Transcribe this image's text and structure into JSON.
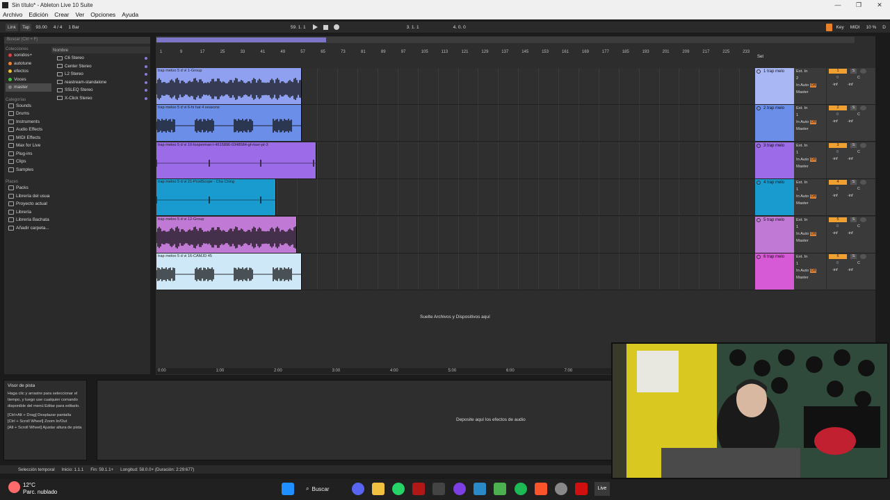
{
  "window": {
    "title": "Sin título* - Ableton Live 10 Suite",
    "controls": [
      "—",
      "❐",
      "✕"
    ]
  },
  "menu": [
    "Archivo",
    "Edición",
    "Crear",
    "Ver",
    "Opciones",
    "Ayuda"
  ],
  "transport": {
    "link": "Link",
    "tap": "Tap",
    "tempo": "93.00",
    "signature": "4 / 4",
    "quantize": "1 Bar",
    "position": "59.  1.  1",
    "loop_start": "3.  1.  1",
    "loop_length": "4.  0.  0",
    "key": "Key",
    "midi": "MIDI",
    "cpu": "10 %",
    "disk": "D"
  },
  "browser": {
    "search_placeholder": "Buscar (Ctrl + F)",
    "collections_label": "Colecciones",
    "collections": [
      {
        "label": "sonidos+",
        "color": "#e04040"
      },
      {
        "label": "autotune",
        "color": "#f08030"
      },
      {
        "label": "efectos",
        "color": "#f0c030"
      },
      {
        "label": "Voces",
        "color": "#40c040"
      },
      {
        "label": "master",
        "color": "#808080"
      }
    ],
    "categories_label": "Categorías",
    "categories": [
      "Sounds",
      "Drums",
      "Instruments",
      "Audio Effects",
      "MIDI Effects",
      "Max for Live",
      "Plug-ins",
      "Clips",
      "Samples"
    ],
    "places_label": "Places",
    "places": [
      "Packs",
      "Librería del usua",
      "Proyecto actual",
      "Librería",
      "Librería Bachata",
      "Añadir carpeta..."
    ],
    "name_header": "Nombre",
    "files": [
      "C6 Stereo",
      "Center Stereo",
      "L2 Stereo",
      "reastream-standalone",
      "SSLEQ Stereo",
      "X-Click Stereo"
    ]
  },
  "ruler": [
    "1",
    "9",
    "17",
    "25",
    "33",
    "41",
    "49",
    "57",
    "65",
    "73",
    "81",
    "89",
    "97",
    "105",
    "113",
    "121",
    "129",
    "137",
    "145",
    "153",
    "161",
    "169",
    "177",
    "185",
    "193",
    "201",
    "209",
    "217",
    "225",
    "233"
  ],
  "set_label": "Set",
  "tracks": [
    {
      "clip": "trap meloo 5 d vi 1-Group",
      "header_color": "#a9b8f5",
      "clip_color": "#8fa0f0",
      "name": "1 trap melo",
      "input": "Ext. In",
      "ch": "2",
      "num": "1"
    },
    {
      "clip": "trap meloo 5 d vi 6-hi hat 4 seasons",
      "header_color": "#6b8ee8",
      "clip_color": "#6b8ee8",
      "name": "2 trap melo",
      "input": "Ext. In",
      "ch": "1",
      "num": "2"
    },
    {
      "clip": "trap meloo 5 d vi 10-looperman-l-4615896-0348584-gf-riser-pt-3",
      "header_color": "#9b6be8",
      "clip_color": "#9b6be8",
      "name": "3 trap melo",
      "input": "Ext. In",
      "ch": "1",
      "num": "3"
    },
    {
      "clip": "trap meloo 5 d vi 21-ProdScope - Cha Ching",
      "header_color": "#1a9bd0",
      "clip_color": "#1a9bd0",
      "name": "4 trap melo",
      "input": "Ext. In",
      "ch": "1",
      "num": "4"
    },
    {
      "clip": "trap meloo 5 d vi 12-Group",
      "header_color": "#c07ad6",
      "clip_color": "#c07ad6",
      "name": "5 trap melo",
      "input": "Ext. In",
      "ch": "1",
      "num": "5"
    },
    {
      "clip": "trap meloo 5 d vi 16-CAMJD 45",
      "header_color": "#d65ad6",
      "clip_color": "#cfe8f8",
      "name": "6 trap melo",
      "input": "Ext. In",
      "ch": "1",
      "num": "6"
    }
  ],
  "track_controls": {
    "in": "In",
    "auto": "Auto",
    "off": "Off",
    "master": "Master",
    "zero": "0",
    "c": "C",
    "inf": "-inf",
    "s": "S"
  },
  "drop_files_text": "Suelte Archivos y Dispositivos aquí",
  "timeline": [
    "0:00",
    "1:00",
    "2:00",
    "3:00",
    "4:00",
    "5:00",
    "6:00",
    "7:00"
  ],
  "info_view": {
    "title": "Visor de pista",
    "lines": [
      "Haga clic y arrastre para seleccionar el tiempo, y luego use cualquier comando disponible del menú Editar para editarlo.",
      "[Ctrl+Alt + Drag] Desplazar pantalla",
      "[Ctrl + Scroll Wheel] Zoom In/Out",
      "[Alt + Scroll Wheel] Ajustar altura de pista"
    ]
  },
  "drop_effects_text": "Deposite aquí los efectos de audio",
  "status": {
    "label": "Selección temporal",
    "start": "Inicio: 1.1.1",
    "end": "Fin: 59.1.1+",
    "length": "Longitud: 58.0.0+ (Duración: 2:29:677)"
  },
  "taskbar": {
    "temp": "12°C",
    "weather": "Parc. nublado",
    "search": "Buscar",
    "live": "Live"
  }
}
